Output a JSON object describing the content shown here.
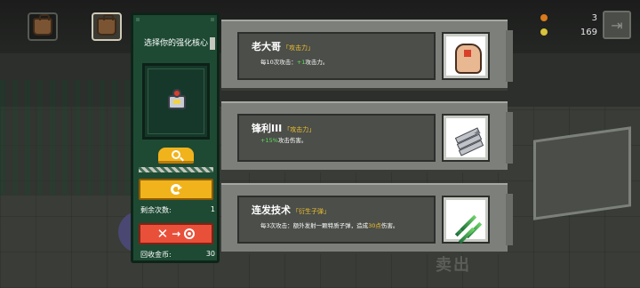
{
  "hud": {
    "slot1_icon": "backpack-icon",
    "slot2_icon": "backpack-icon",
    "stat1_value": "3",
    "stat2_value": "169",
    "exit_icon": "exit-icon"
  },
  "panel": {
    "title": "选择你的强化核心",
    "core_icon": "robot-core-icon",
    "search_icon": "magnifier-icon",
    "refresh_icon": "refresh-icon",
    "remaining_label": "剩余次数:",
    "remaining_value": "1",
    "recycle_icon": "recycle-to-coin-icon",
    "recycle_label": "回收金币:",
    "recycle_value": "30"
  },
  "cards": [
    {
      "name": "老大哥",
      "tag": "「攻击力」",
      "desc_prefix": "每10次攻击：",
      "desc_highlight": "+1",
      "desc_suffix": "攻击力。",
      "highlight_color": "#5ee05a",
      "icon": "thumbs-up-icon"
    },
    {
      "name": "锋利III",
      "tag": "「攻击力」",
      "desc_prefix": "",
      "desc_highlight": "+15%",
      "desc_suffix": "攻击伤害。",
      "highlight_color": "#5ee05a",
      "icon": "blade-stack-icon"
    },
    {
      "name": "连发技术",
      "tag": "「衍生子弹」",
      "desc_prefix": "每3次攻击：额外发射一颗特质子弹，造成",
      "desc_highlight": "30点",
      "desc_suffix": "伤害。",
      "highlight_color": "#f2c12e",
      "icon": "green-shards-icon"
    }
  ],
  "background": {
    "sign_text": "卖出"
  }
}
